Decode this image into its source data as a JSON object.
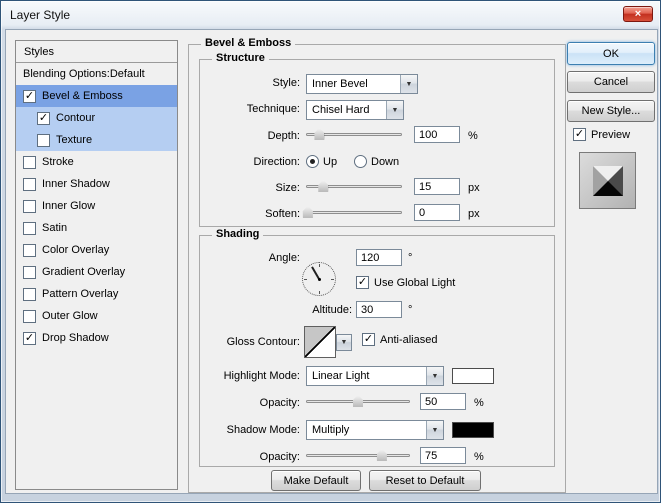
{
  "window": {
    "title": "Layer Style",
    "close": "×"
  },
  "sidebar": {
    "header": "Styles",
    "items": [
      {
        "label": "Blending Options:Default"
      },
      {
        "label": "Bevel & Emboss",
        "check": "✓"
      },
      {
        "label": "Contour",
        "check": "✓"
      },
      {
        "label": "Texture",
        "check": ""
      },
      {
        "label": "Stroke",
        "check": ""
      },
      {
        "label": "Inner Shadow",
        "check": ""
      },
      {
        "label": "Inner Glow",
        "check": ""
      },
      {
        "label": "Satin",
        "check": ""
      },
      {
        "label": "Color Overlay",
        "check": ""
      },
      {
        "label": "Gradient Overlay",
        "check": ""
      },
      {
        "label": "Pattern Overlay",
        "check": ""
      },
      {
        "label": "Outer Glow",
        "check": ""
      },
      {
        "label": "Drop Shadow",
        "check": "✓"
      }
    ]
  },
  "panel": {
    "title": "Bevel & Emboss",
    "structure": {
      "legend": "Structure",
      "style": {
        "label": "Style:",
        "value": "Inner Bevel"
      },
      "technique": {
        "label": "Technique:",
        "value": "Chisel Hard"
      },
      "depth": {
        "label": "Depth:",
        "value": "100",
        "unit": "%",
        "percent": 14
      },
      "direction": {
        "label": "Direction:",
        "up": "Up",
        "down": "Down"
      },
      "size": {
        "label": "Size:",
        "value": "15",
        "unit": "px",
        "percent": 18
      },
      "soften": {
        "label": "Soften:",
        "value": "0",
        "unit": "px",
        "percent": 2
      }
    },
    "shading": {
      "legend": "Shading",
      "angle": {
        "label": "Angle:",
        "value": "120",
        "unit": "°",
        "degrees": 120
      },
      "use_global_light": {
        "label": "Use Global Light",
        "check": "✓"
      },
      "altitude": {
        "label": "Altitude:",
        "value": "30",
        "unit": "°"
      },
      "gloss_contour": {
        "label": "Gloss Contour:"
      },
      "anti_aliased": {
        "label": "Anti-aliased",
        "check": "✓"
      },
      "highlight_mode": {
        "label": "Highlight Mode:",
        "value": "Linear Light",
        "color": "#ffffff"
      },
      "highlight_opacity": {
        "label": "Opacity:",
        "value": "50",
        "unit": "%",
        "percent": 50
      },
      "shadow_mode": {
        "label": "Shadow Mode:",
        "value": "Multiply",
        "color": "#000000"
      },
      "shadow_opacity": {
        "label": "Opacity:",
        "value": "75",
        "unit": "%",
        "percent": 73
      }
    },
    "footer": {
      "make_default": "Make Default",
      "reset_to_default": "Reset to Default"
    }
  },
  "actions": {
    "ok": "OK",
    "cancel": "Cancel",
    "new_style": "New Style...",
    "preview": {
      "label": "Preview",
      "check": "✓"
    }
  }
}
